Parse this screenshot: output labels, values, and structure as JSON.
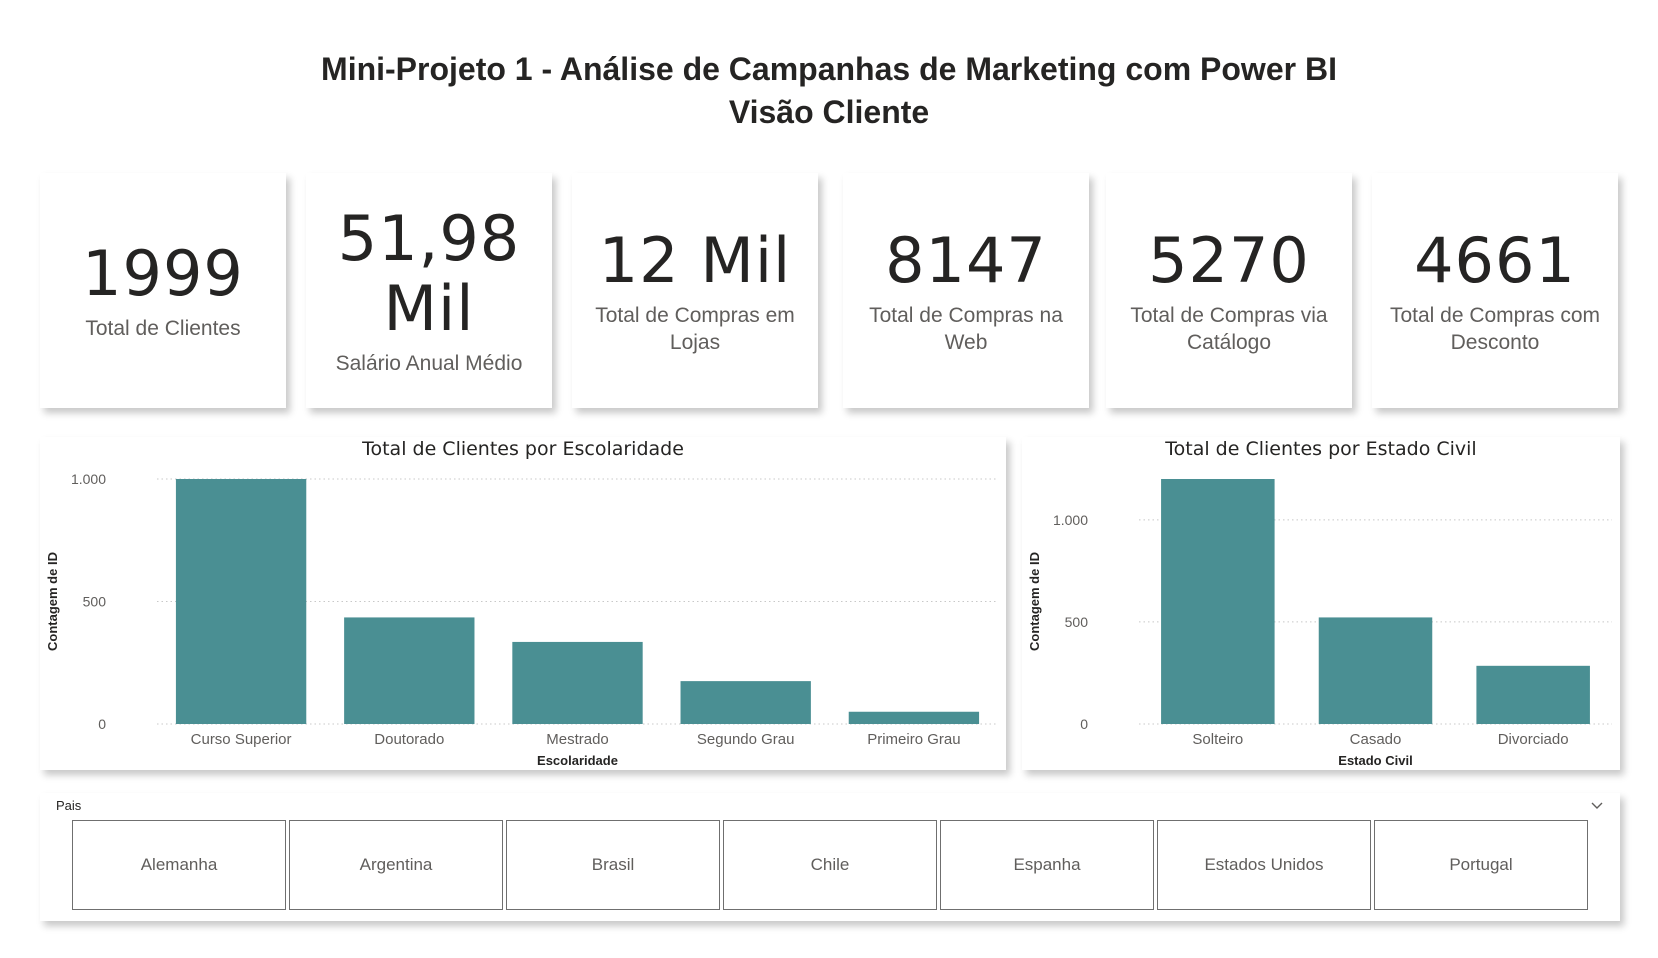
{
  "header": {
    "title_line1": "Mini-Projeto 1 - Análise de Campanhas de Marketing com Power BI",
    "title_line2": "Visão Cliente"
  },
  "kpis": [
    {
      "value": "1999",
      "label": "Total de Clientes"
    },
    {
      "value": "51,98 Mil",
      "label": "Salário Anual Médio"
    },
    {
      "value": "12 Mil",
      "label": "Total de Compras em Lojas"
    },
    {
      "value": "8147",
      "label": "Total de Compras na Web"
    },
    {
      "value": "5270",
      "label": "Total de Compras via Catálogo"
    },
    {
      "value": "4661",
      "label": "Total de Compras com Desconto"
    }
  ],
  "chart_data": [
    {
      "type": "bar",
      "title": "Total de Clientes por Escolaridade",
      "xlabel": "Escolaridade",
      "ylabel": "Contagem de ID",
      "categories": [
        "Curso Superior",
        "Doutorado",
        "Mestrado",
        "Segundo Grau",
        "Primeiro Grau"
      ],
      "values": [
        1000,
        435,
        335,
        175,
        50
      ],
      "ylim": [
        0,
        1000
      ],
      "yticks": [
        0,
        500,
        1000
      ],
      "ytick_labels": [
        "0",
        "500",
        "1.000"
      ],
      "grid": true,
      "color": "#4a8f93"
    },
    {
      "type": "bar",
      "title": "Total de Clientes por Estado Civil",
      "xlabel": "Estado Civil",
      "ylabel": "Contagem de ID",
      "categories": [
        "Solteiro",
        "Casado",
        "Divorciado"
      ],
      "values": [
        1200,
        522,
        285
      ],
      "ylim": [
        0,
        1200
      ],
      "yticks": [
        0,
        500,
        1000
      ],
      "ytick_labels": [
        "0",
        "500",
        "1.000"
      ],
      "grid": true,
      "color": "#4a8f93"
    }
  ],
  "slicer": {
    "title": "Pais",
    "options": [
      "Alemanha",
      "Argentina",
      "Brasil",
      "Chile",
      "Espanha",
      "Estados Unidos",
      "Portugal"
    ]
  },
  "colors": {
    "bar": "#4a8f93",
    "text_dark": "#252423",
    "text_muted": "#605e5c"
  }
}
